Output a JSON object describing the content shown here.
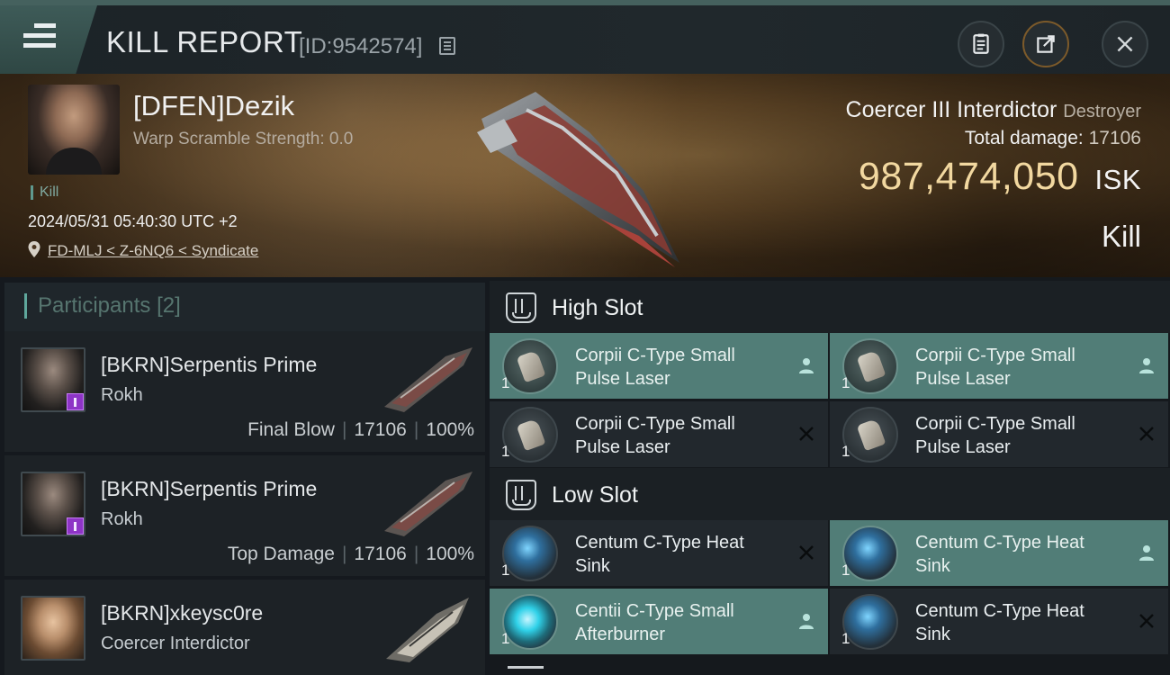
{
  "header": {
    "title": "KILL REPORT",
    "report_id": "[ID:9542574]"
  },
  "victim": {
    "name": "[DFEN]Dezik",
    "subtitle": "Warp Scramble Strength: 0.0",
    "tag": "Kill",
    "timestamp": "2024/05/31 05:40:30 UTC +2",
    "location": "FD-MLJ < Z-6NQ6 < Syndicate",
    "ship_name": "Coercer III Interdictor",
    "ship_class": "Destroyer",
    "total_damage_label": "Total damage:",
    "total_damage": "17106",
    "isk_value": "987,474,050",
    "isk_unit": "ISK",
    "result": "Kill"
  },
  "participants": {
    "label": "Participants",
    "count": "[2]",
    "items": [
      {
        "name": "[BKRN]Serpentis Prime",
        "ship": "Rokh",
        "role": "Final Blow",
        "damage": "17106",
        "percent": "100%"
      },
      {
        "name": "[BKRN]Serpentis Prime",
        "ship": "Rokh",
        "role": "Top Damage",
        "damage": "17106",
        "percent": "100%"
      },
      {
        "name": "[BKRN]xkeysc0re",
        "ship": "Coercer Interdictor"
      }
    ]
  },
  "fitting": {
    "high_slot": {
      "label": "High Slot",
      "modules": [
        {
          "line1": "Corpii C-Type Small",
          "line2": "Pulse Laser",
          "qty": "1",
          "state": "fitted",
          "icon": "laser-icon"
        },
        {
          "line1": "Corpii C-Type Small",
          "line2": "Pulse Laser",
          "qty": "1",
          "state": "fitted",
          "icon": "laser-icon"
        },
        {
          "line1": "Corpii C-Type Small",
          "line2": "Pulse Laser",
          "qty": "1",
          "state": "destroyed",
          "icon": "laser-icon"
        },
        {
          "line1": "Corpii C-Type Small",
          "line2": "Pulse Laser",
          "qty": "1",
          "state": "destroyed",
          "icon": "laser-icon"
        }
      ]
    },
    "low_slot": {
      "label": "Low Slot",
      "modules": [
        {
          "line1": "Centum C-Type Heat",
          "line2": "Sink",
          "qty": "1",
          "state": "destroyed",
          "icon": "heat-sink-icon"
        },
        {
          "line1": "Centum C-Type Heat",
          "line2": "Sink",
          "qty": "1",
          "state": "fitted",
          "icon": "heat-sink-icon"
        },
        {
          "line1": "Centii C-Type Small",
          "line2": "Afterburner",
          "qty": "1",
          "state": "fitted",
          "icon": "afterburner-icon"
        },
        {
          "line1": "Centum C-Type Heat",
          "line2": "Sink",
          "qty": "1",
          "state": "destroyed",
          "icon": "heat-sink-icon"
        }
      ]
    }
  },
  "colors": {
    "accent_teal": "#517d77",
    "isk_gold": "#f2d8a0",
    "badge_purple": "#8e34c6"
  }
}
